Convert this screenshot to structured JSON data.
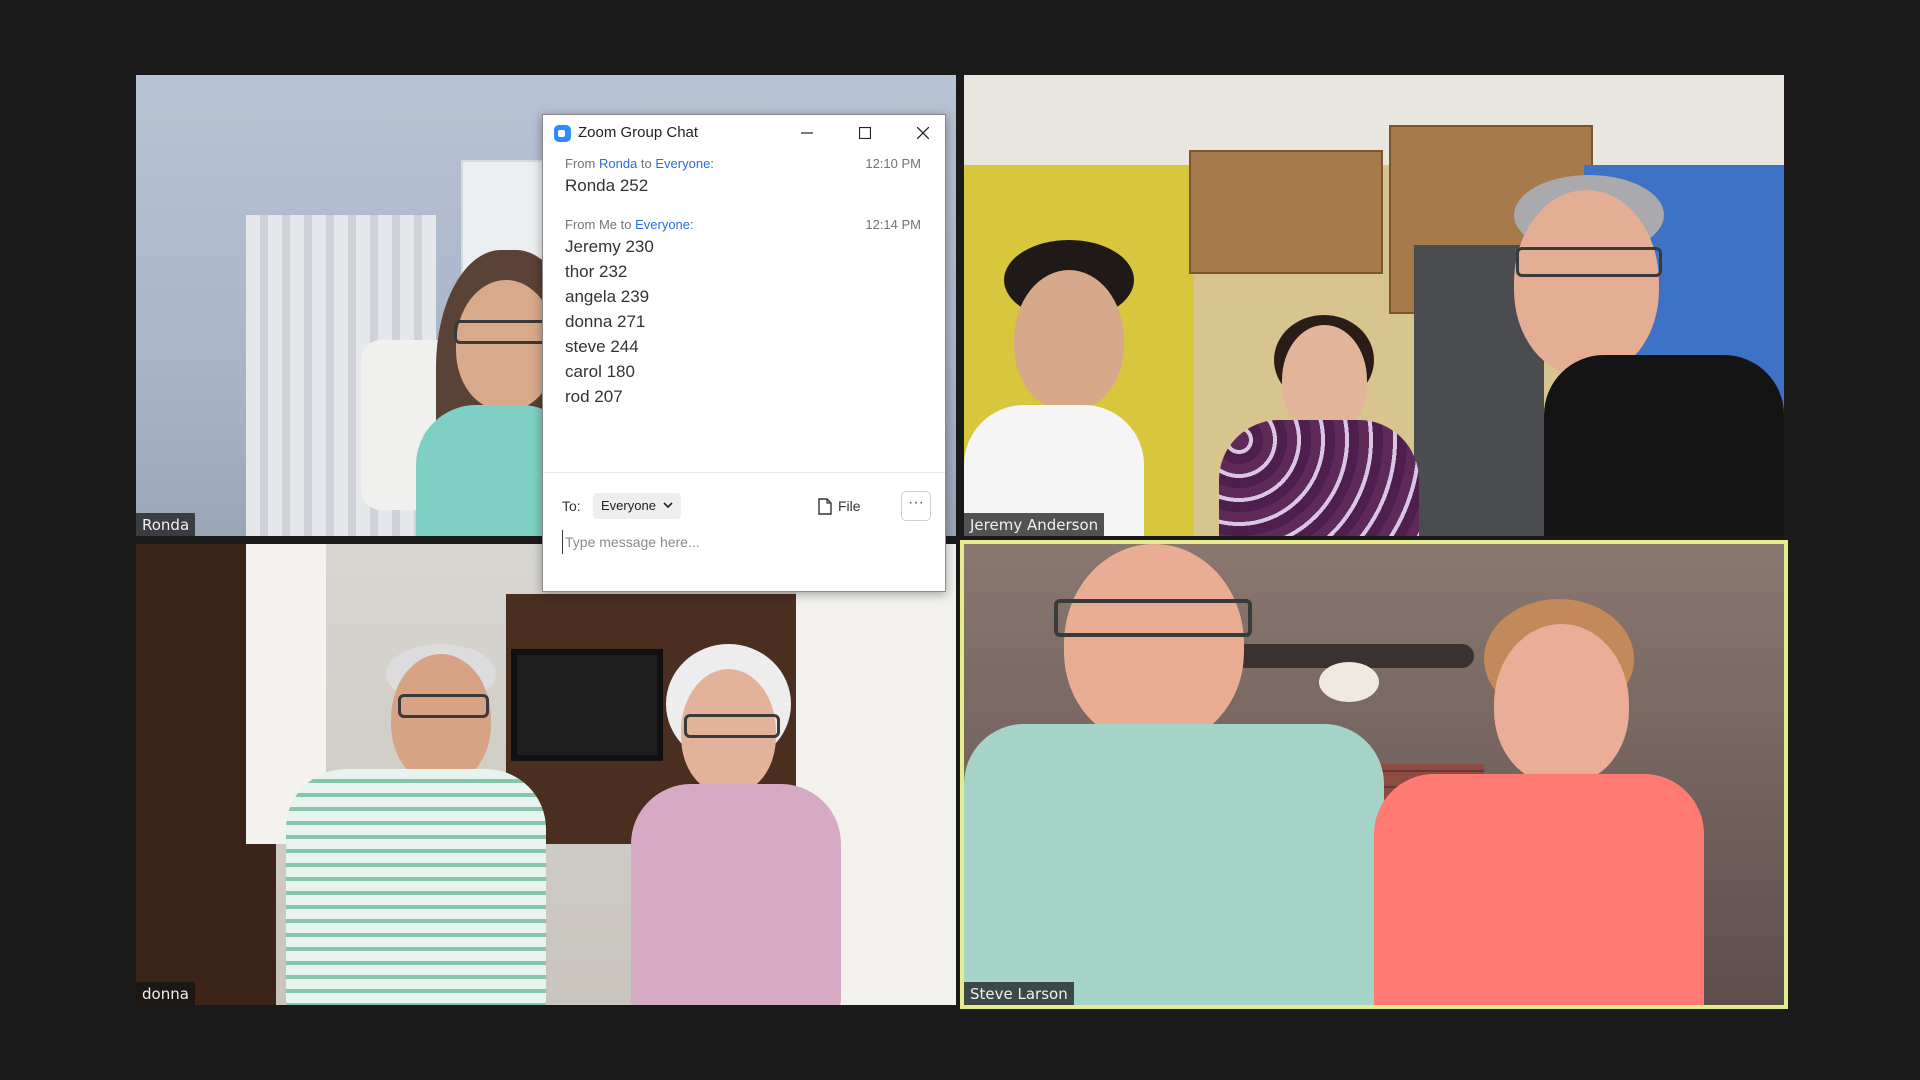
{
  "tiles": [
    {
      "id": "ronda",
      "name": "Ronda"
    },
    {
      "id": "jeremy",
      "name": "Jeremy Anderson"
    },
    {
      "id": "donna",
      "name": "donna"
    },
    {
      "id": "steve",
      "name": "Steve Larson",
      "active": true
    }
  ],
  "chat": {
    "title": "Zoom Group Chat",
    "messages": [
      {
        "from_prefix": "From",
        "from": "Ronda",
        "to_word": "to",
        "to": "Everyone:",
        "time": "12:10 PM",
        "lines": [
          "Ronda 252"
        ]
      },
      {
        "from_prefix": "From Me to",
        "to": "Everyone:",
        "time": "12:14 PM",
        "lines": [
          "Jeremy 230",
          "thor 232",
          "angela 239",
          "donna 271",
          "steve 244",
          "carol 180",
          "rod 207"
        ]
      }
    ],
    "to_label": "To:",
    "recipient": "Everyone",
    "file_label": "File",
    "more_label": "···",
    "input_placeholder": "Type message here..."
  },
  "colors": {
    "accent": "#2d8cff",
    "active_border": "#e6ec8c",
    "background": "#1a1a1a"
  }
}
